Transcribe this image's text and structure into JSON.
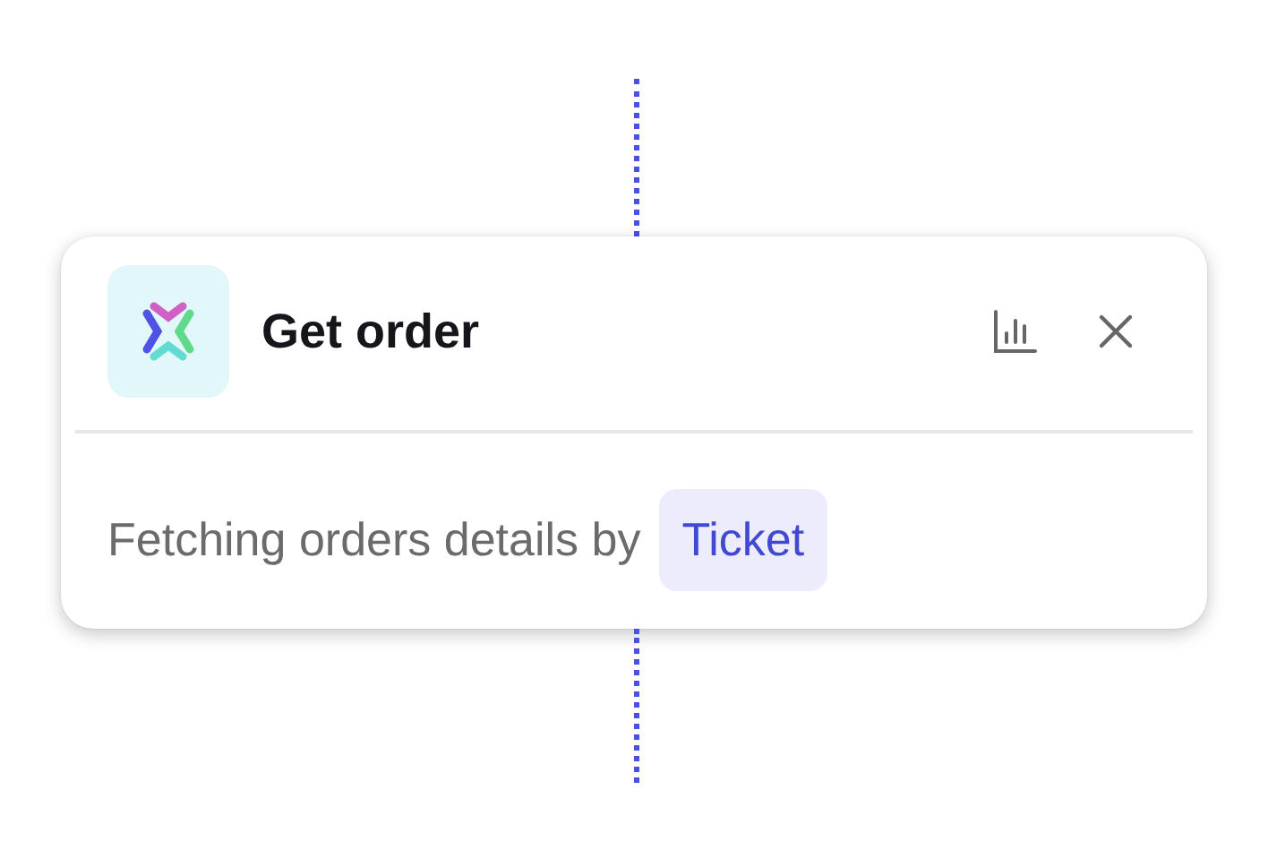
{
  "node": {
    "title": "Get order",
    "description": "Fetching orders details by",
    "tag": "Ticket"
  }
}
